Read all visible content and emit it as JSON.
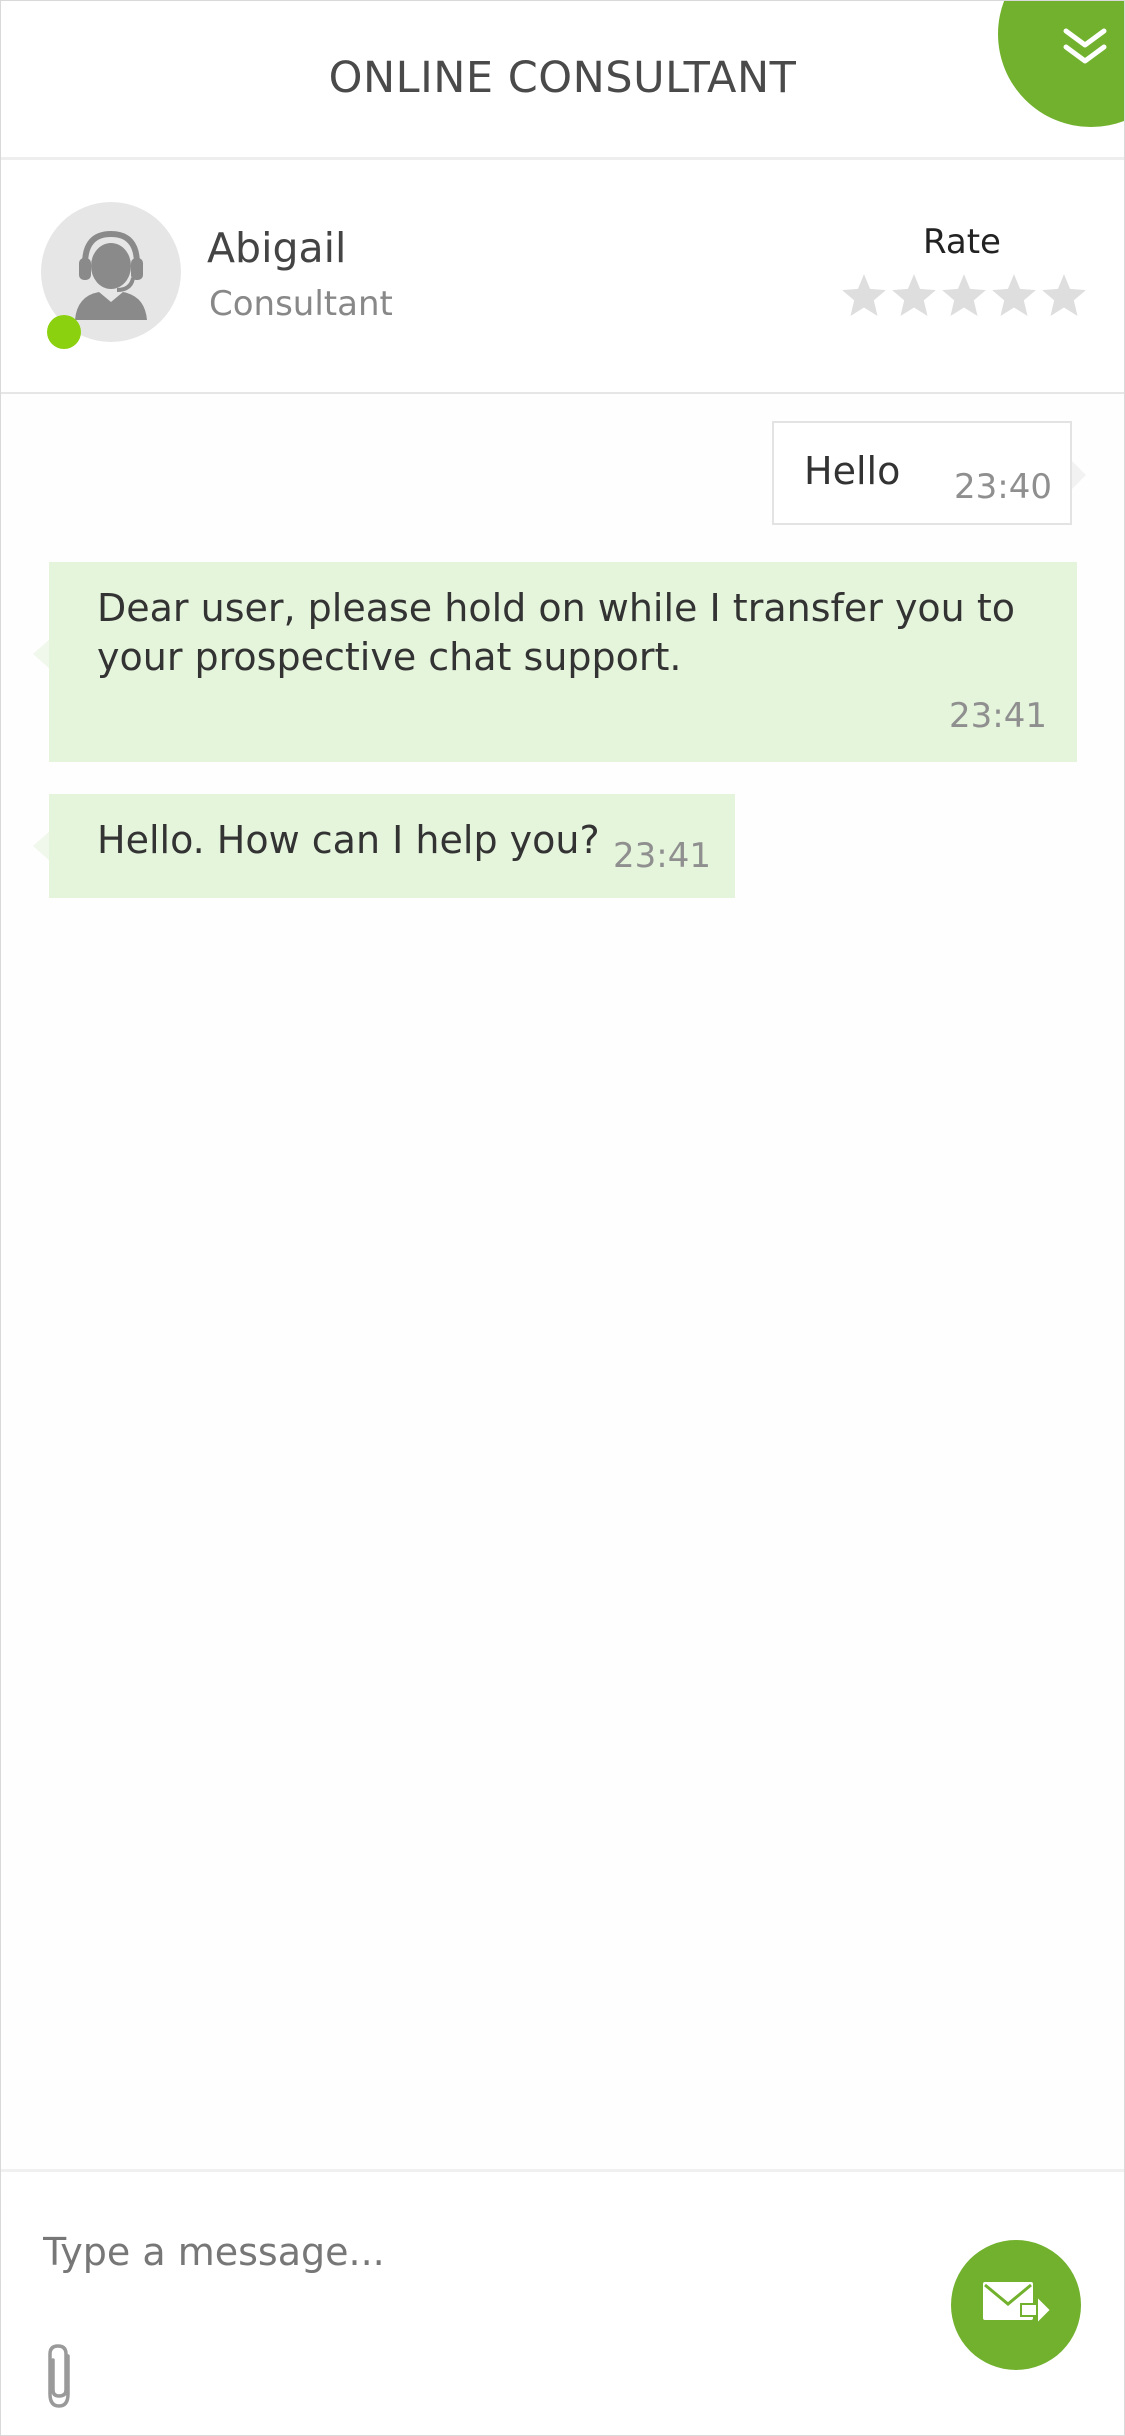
{
  "header": {
    "title": "ONLINE CONSULTANT",
    "collapse_icon": "chevron-double-down-icon"
  },
  "agent": {
    "name": "Abigail",
    "role": "Consultant",
    "status": "online",
    "avatar_icon": "headset-user-icon",
    "rate_label": "Rate",
    "rating_stars": 5,
    "rating_value": 0
  },
  "messages": [
    {
      "from": "user",
      "text": "Hello",
      "time": "23:40"
    },
    {
      "from": "agent",
      "text": "Dear user, please hold on while I transfer you to your prospective chat support.",
      "time": "23:41"
    },
    {
      "from": "agent",
      "text": "Hello. How can I help you?",
      "time": "23:41"
    }
  ],
  "composer": {
    "placeholder": "Type a message...",
    "value": "",
    "attach_icon": "paperclip-icon",
    "send_icon": "envelope-send-icon"
  },
  "colors": {
    "accent": "#72b12d",
    "status_online": "#8bd10f",
    "agent_bubble": "#e5f5dc",
    "star_empty": "#dedede"
  }
}
